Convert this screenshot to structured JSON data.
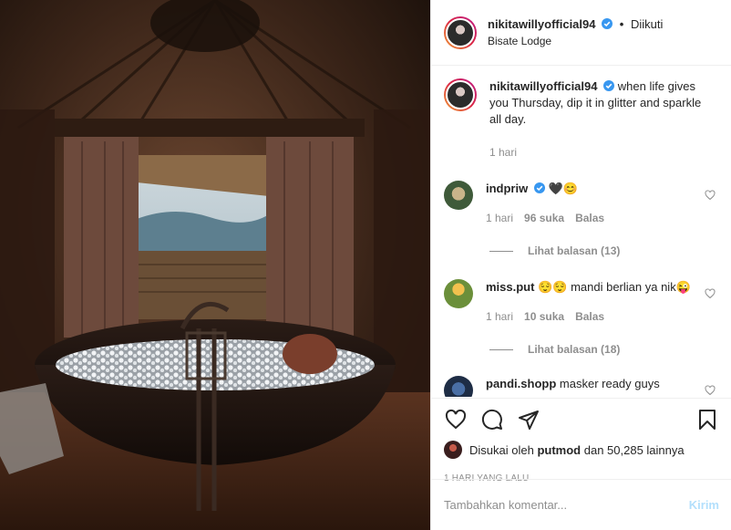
{
  "post": {
    "username": "nikitawillyofficial94",
    "follow_state": "Diikuti",
    "location": "Bisate Lodge",
    "caption": "when life gives you Thursday, dip it in glitter and sparkle all day.",
    "caption_time": "1 hari",
    "verified_icon": "verified-badge-icon",
    "accent_color": "#3897f0"
  },
  "comments": [
    {
      "username": "indpriw",
      "verified": true,
      "text": "🖤😊",
      "time": "1 hari",
      "likes": "96 suka",
      "reply": "Balas",
      "view_replies": "Lihat balasan (13)"
    },
    {
      "username": "miss.put",
      "verified": false,
      "text": "😌😌 mandi berlian ya nik😜",
      "time": "1 hari",
      "likes": "10 suka",
      "reply": "Balas",
      "view_replies": "Lihat balasan (18)"
    },
    {
      "username": "pandi.shopp",
      "text": "masker ready guys"
    }
  ],
  "actions": {
    "liked_by_prefix": "Disukai oleh",
    "liked_by_user": "putmod",
    "liked_by_suffix": "dan 50,285 lainnya",
    "time_ago": "1 HARI YANG LALU"
  },
  "add_comment": {
    "placeholder": "Tambahkan komentar...",
    "post_label": "Kirim"
  }
}
